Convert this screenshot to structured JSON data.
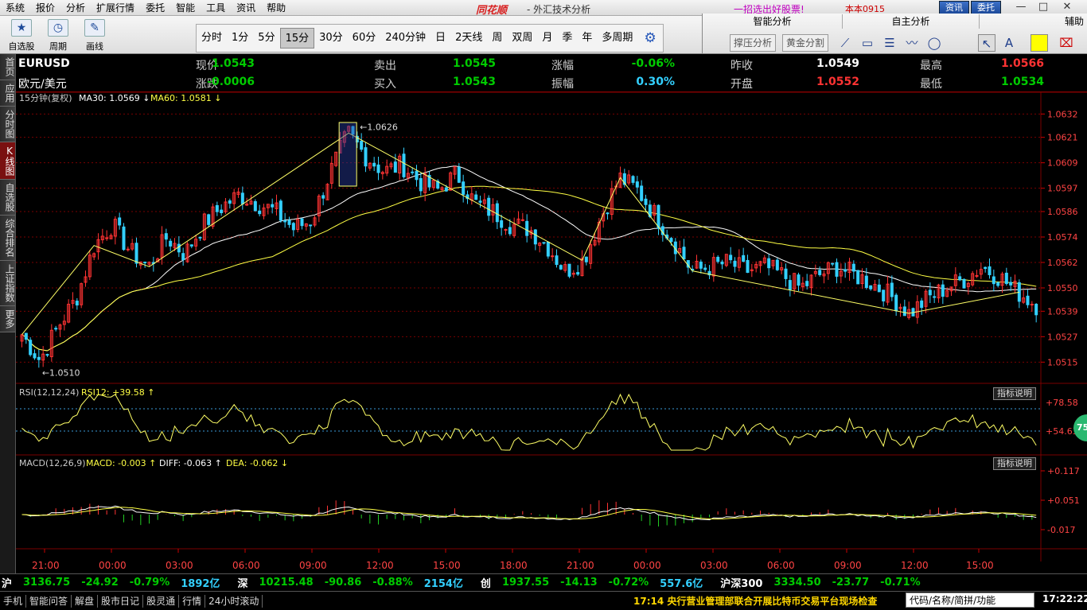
{
  "menu": [
    "系统",
    "报价",
    "分析",
    "扩展行情",
    "委托",
    "智能",
    "工具",
    "资讯",
    "帮助"
  ],
  "brand": "同花顺",
  "window_title": "- 外汇技术分析",
  "promo": "一招选出好股票!",
  "user": "本本0915",
  "top_buttons": [
    "资讯",
    "委托"
  ],
  "window_controls": [
    "—",
    "□",
    "✕"
  ],
  "toolbar": [
    {
      "label": "自选股",
      "icon": "star-icon"
    },
    {
      "label": "周期",
      "icon": "clock-icon"
    },
    {
      "label": "画线",
      "icon": "pen-icon"
    }
  ],
  "periods": [
    "分时",
    "1分",
    "5分",
    "15分",
    "30分",
    "60分",
    "240分钟",
    "日",
    "2天线",
    "周",
    "双周",
    "月",
    "季",
    "年",
    "多周期"
  ],
  "active_period": "15分",
  "right_panel": {
    "tabs": [
      "智能分析",
      "自主分析",
      "辅助"
    ],
    "buttons": [
      "撑压分析",
      "黄金分割"
    ]
  },
  "left_nav": [
    "首页",
    "应用",
    "分时图",
    "K线图",
    "自选股",
    "综合排名",
    "上证指数",
    "更多"
  ],
  "active_nav": "K线图",
  "quote": {
    "symbol": "EURUSD",
    "name": "欧元/美元",
    "fields": [
      {
        "label": "现价",
        "value": "1.0543",
        "cls": "qv"
      },
      {
        "label": "涨跌",
        "value": "-0.0006",
        "cls": "qv"
      },
      {
        "label": "卖出",
        "value": "1.0545",
        "cls": "qv"
      },
      {
        "label": "买入",
        "value": "1.0543",
        "cls": "qv"
      },
      {
        "label": "涨幅",
        "value": "-0.06%",
        "cls": "qv"
      },
      {
        "label": "振幅",
        "value": "0.30%",
        "cls": "qa"
      },
      {
        "label": "昨收",
        "value": "1.0549",
        "cls": "qw"
      },
      {
        "label": "开盘",
        "value": "1.0552",
        "cls": "qr"
      },
      {
        "label": "最高",
        "value": "1.0566",
        "cls": "qr"
      },
      {
        "label": "最低",
        "value": "1.0534",
        "cls": "qv"
      }
    ]
  },
  "indicators": {
    "main": {
      "prefix": "15分钟(复权)",
      "ma30": "MA30: 1.0569",
      "ma60": "MA60: 1.0581"
    },
    "rsi": {
      "label": "RSI(12,12,24)",
      "value": "RSI12: +39.58"
    },
    "macd": {
      "label": "MACD(12,26,9)",
      "macd": "MACD: -0.003",
      "diff": "DIFF: -0.063",
      "dea": "DEA: -0.062"
    },
    "explain": "指标说明",
    "badge": "75"
  },
  "chart_data": {
    "type": "candlestick",
    "price_axis": [
      "1.0632",
      "1.0621",
      "1.0609",
      "1.0597",
      "1.0586",
      "1.0574",
      "1.0562",
      "1.0550",
      "1.0539",
      "1.0527",
      "1.0515"
    ],
    "ylim": [
      1.0505,
      1.0637
    ],
    "rsi_axis": [
      "+78.58",
      "+54.63"
    ],
    "macd_axis": [
      "+0.117",
      "+0.051",
      "-0.017"
    ],
    "time_axis": [
      "21:00",
      "00:00",
      "03:00",
      "06:00",
      "09:00",
      "12:00",
      "15:00",
      "18:00",
      "21:00",
      "00:00",
      "03:00",
      "06:00",
      "09:00",
      "12:00",
      "15:00"
    ],
    "high_label": "1.0626",
    "low_label": "1.0510",
    "anchors": [
      1.0528,
      1.0516,
      1.0532,
      1.0545,
      1.057,
      1.058,
      1.0567,
      1.056,
      1.0574,
      1.0566,
      1.058,
      1.0588,
      1.0594,
      1.059,
      1.0586,
      1.0578,
      1.0582,
      1.0604,
      1.0623,
      1.0612,
      1.0605,
      1.0608,
      1.06,
      1.0596,
      1.0604,
      1.059,
      1.0586,
      1.058,
      1.0578,
      1.057,
      1.0558,
      1.0563,
      1.0584,
      1.0602,
      1.0596,
      1.0584,
      1.0572,
      1.0558,
      1.056,
      1.0562,
      1.0558,
      1.056,
      1.0556,
      1.055,
      1.0556,
      1.056,
      1.0556,
      1.0552,
      1.0546,
      1.0538,
      1.0545,
      1.055,
      1.0554,
      1.056,
      1.0555,
      1.0548,
      1.0542
    ]
  },
  "status": {
    "items": [
      {
        "t": "沪",
        "c": "#fff"
      },
      {
        "t": "3136.75",
        "c": "#0c0"
      },
      {
        "t": "-24.92",
        "c": "#0c0"
      },
      {
        "t": "-0.79%",
        "c": "#0c0"
      },
      {
        "t": "1892亿",
        "c": "#33d0ff"
      },
      {
        "t": "深",
        "c": "#fff"
      },
      {
        "t": "10215.48",
        "c": "#0c0"
      },
      {
        "t": "-90.86",
        "c": "#0c0"
      },
      {
        "t": "-0.88%",
        "c": "#0c0"
      },
      {
        "t": "2154亿",
        "c": "#33d0ff"
      },
      {
        "t": "创",
        "c": "#fff"
      },
      {
        "t": "1937.55",
        "c": "#0c0"
      },
      {
        "t": "-14.13",
        "c": "#0c0"
      },
      {
        "t": "-0.72%",
        "c": "#0c0"
      },
      {
        "t": "557.6亿",
        "c": "#33d0ff"
      },
      {
        "t": "沪深300",
        "c": "#fff"
      },
      {
        "t": "3334.50",
        "c": "#0c0"
      },
      {
        "t": "-23.77",
        "c": "#0c0"
      },
      {
        "t": "-0.71%",
        "c": "#0c0"
      }
    ]
  },
  "bottom": {
    "buttons": [
      "手机",
      "智能问答",
      "解盘",
      "股市日记",
      "股灵通",
      "行情",
      "24小时滚动"
    ],
    "news": "17:14 央行营业管理部联合开展比特币交易平台现场检查",
    "search_placeholder": "代码/名称/简拼/功能",
    "clock": "17:22:22"
  },
  "colors": {
    "up": "#ff3333",
    "down": "#33d0ff",
    "ma_fast": "#ffffff",
    "ma_slow": "#ffff44",
    "grid": "#7a0000"
  }
}
